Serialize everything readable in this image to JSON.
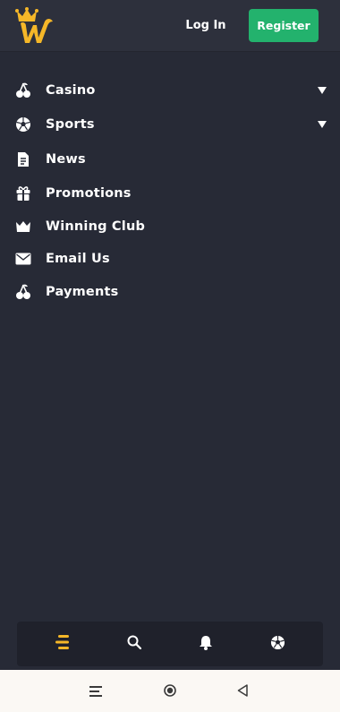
{
  "header": {
    "logo_name": "crown-w-logo",
    "login_label": "Log In",
    "register_label": "Register",
    "colors": {
      "accent": "#f5b728",
      "register_bg": "#23b26d",
      "background": "#272a36"
    }
  },
  "menu": {
    "items": [
      {
        "label": "Casino",
        "icon": "cherries-icon",
        "has_dropdown": true
      },
      {
        "label": "Sports",
        "icon": "soccer-ball-icon",
        "has_dropdown": true
      },
      {
        "label": "News",
        "icon": "document-icon",
        "has_dropdown": false
      },
      {
        "label": "Promotions",
        "icon": "gift-icon",
        "has_dropdown": false
      },
      {
        "label": "Winning Club",
        "icon": "crown-icon",
        "has_dropdown": false
      },
      {
        "label": "Email Us",
        "icon": "envelope-icon",
        "has_dropdown": false
      },
      {
        "label": "Payments",
        "icon": "cherries-icon",
        "has_dropdown": false
      }
    ]
  },
  "bottom_nav": {
    "items": [
      {
        "icon": "menu-icon",
        "active": true
      },
      {
        "icon": "search-icon",
        "active": false
      },
      {
        "icon": "bell-icon",
        "active": false
      },
      {
        "icon": "soccer-ball-icon",
        "active": false
      }
    ]
  },
  "system_nav": {
    "items": [
      {
        "icon": "recent-apps-icon"
      },
      {
        "icon": "home-icon"
      },
      {
        "icon": "back-icon"
      }
    ]
  }
}
